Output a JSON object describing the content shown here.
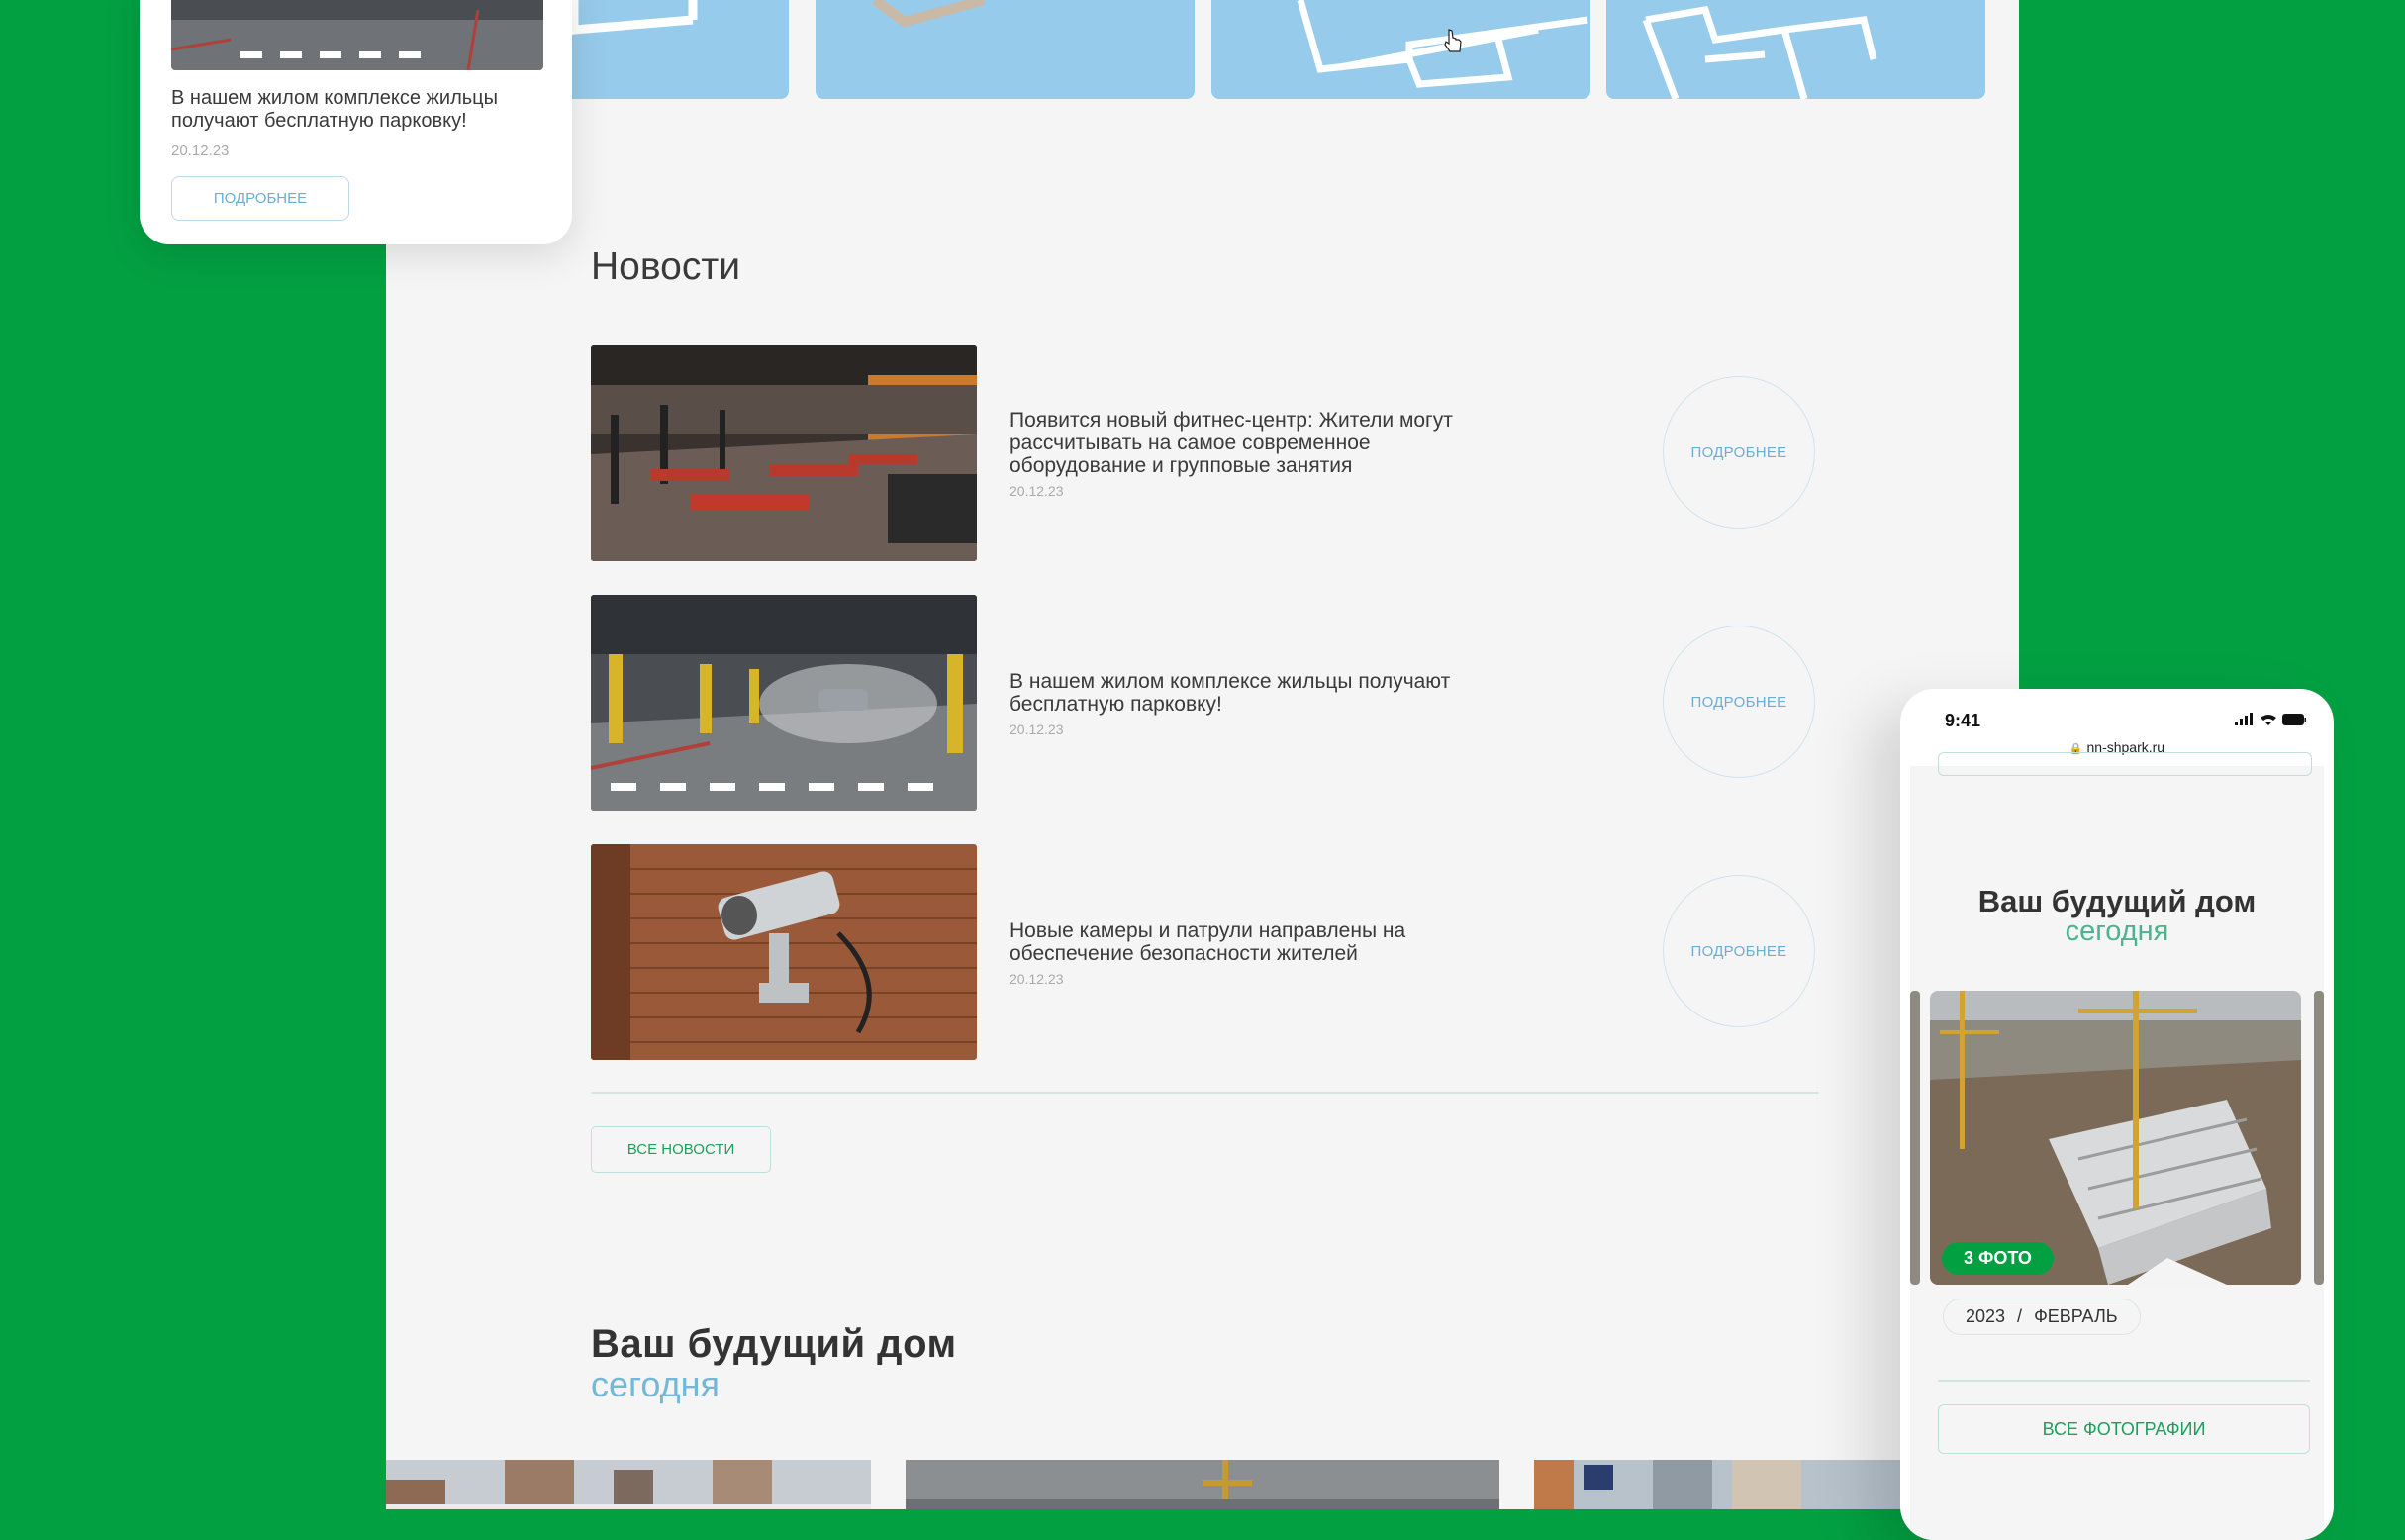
{
  "news": {
    "section_title": "Новости",
    "items": [
      {
        "text": "Появится новый фитнес-центр: Жители могут рассчитывать на самое современное оборудование и групповые занятия",
        "date": "20.12.23",
        "button": "ПОДРОБНЕЕ",
        "image": "gym-photo"
      },
      {
        "text": "В нашем жилом комплексе жильцы получают бесплатную парковку!",
        "date": "20.12.23",
        "button": "ПОДРОБНЕЕ",
        "image": "parking-photo"
      },
      {
        "text": "Новые камеры и патрули направлены на обеспечение безопасности жителей",
        "date": "20.12.23",
        "button": "ПОДРОБНЕЕ",
        "image": "camera-photo"
      }
    ],
    "all_button": "ВСЕ НОВОСТИ"
  },
  "future": {
    "title": "Ваш будущий дом",
    "subtitle": "сегодня"
  },
  "mobile_card": {
    "text": "В нашем жилом комплексе жильцы получают бесплатную парковку!",
    "date": "20.12.23",
    "button": "ПОДРОБНЕЕ"
  },
  "phone": {
    "time": "9:41",
    "url": "nn-shpark.ru",
    "title": "Ваш будущий дом",
    "subtitle": "сегодня",
    "photo_badge": "3 ФОТО",
    "date_year": "2023",
    "date_sep": "/",
    "date_month": "ФЕВРАЛЬ",
    "all_photos_button": "ВСЕ ФОТОГРАФИИ"
  },
  "colors": {
    "brand_green": "#03a042",
    "accent_blue": "#73b8d6",
    "accent_teal": "#4bb48c",
    "page_bg": "#f5f5f5"
  }
}
